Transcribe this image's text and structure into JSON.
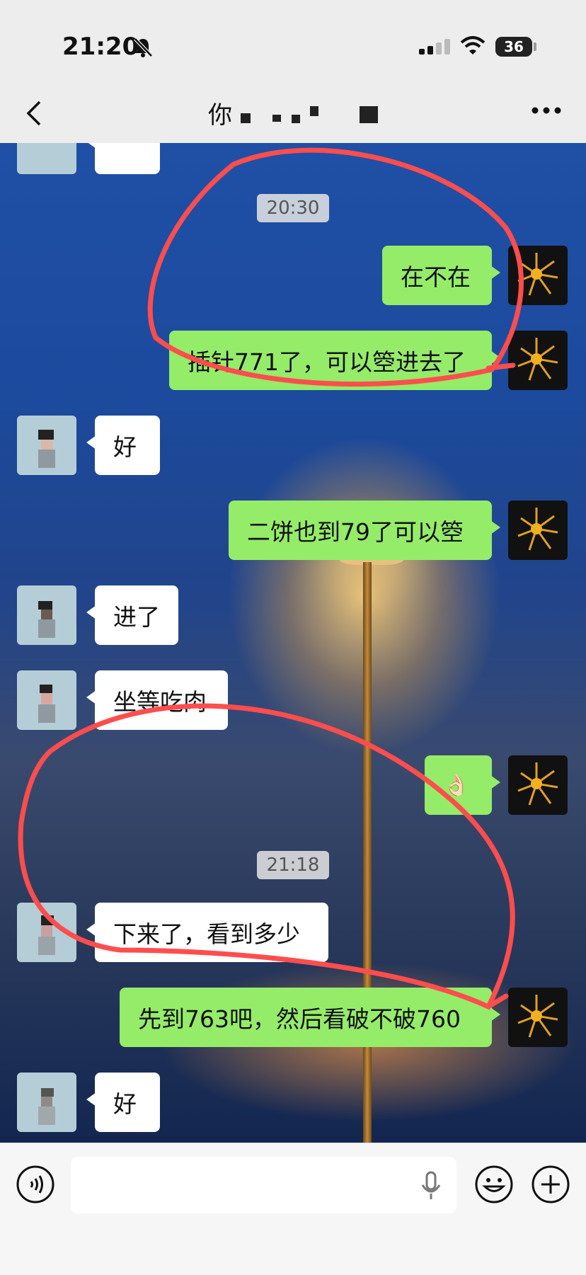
{
  "status": {
    "time": "21:20",
    "battery": "36"
  },
  "header": {
    "title_visible": "你"
  },
  "chat": {
    "messages": [
      {
        "side": "right",
        "text": "在不在"
      },
      {
        "side": "right",
        "text": "插针771了，可以箜进去了"
      },
      {
        "side": "left",
        "text": "好"
      },
      {
        "side": "right",
        "text": "二饼也到79了可以箜"
      },
      {
        "side": "left",
        "text": "进了"
      },
      {
        "side": "left",
        "text": "坐等吃肉"
      },
      {
        "side": "right",
        "text": "👌🏻"
      },
      {
        "side": "left",
        "text": "下来了，看到多少"
      },
      {
        "side": "right",
        "text": "先到763吧，然后看破不破760"
      },
      {
        "side": "left",
        "text": "好"
      }
    ],
    "timestamps": [
      "20:30",
      "21:18"
    ]
  },
  "colors": {
    "self_bubble": "#95ec69",
    "other_bubble": "#ffffff",
    "annotation": "#ff4d4d"
  },
  "icons": [
    "back-icon",
    "more-icon",
    "voice-icon",
    "microphone-icon",
    "emoji-icon",
    "plus-icon",
    "mute-bell-icon",
    "wifi-icon",
    "signal-icon"
  ]
}
